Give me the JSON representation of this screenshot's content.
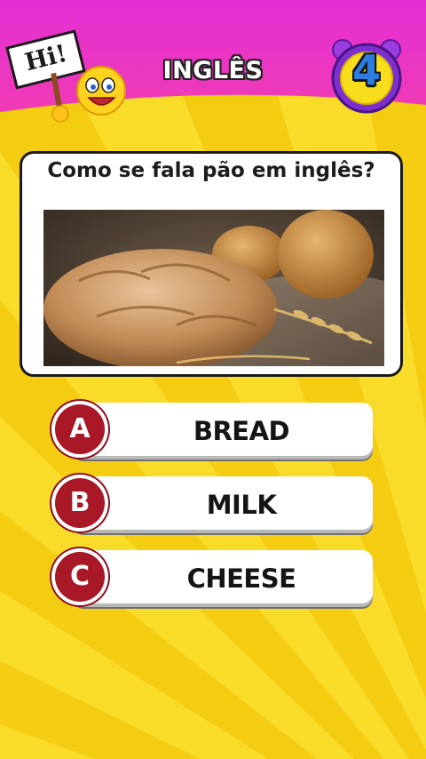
{
  "header": {
    "title": "INGLÊS",
    "sign_text": "Hi!",
    "timer_value": "4"
  },
  "question": {
    "text": "Como se fala pão em inglês?",
    "image_subject": "bread loaves with wheat stalks"
  },
  "answers": [
    {
      "letter": "A",
      "label": "BREAD"
    },
    {
      "letter": "B",
      "label": "MILK"
    },
    {
      "letter": "C",
      "label": "CHEESE"
    }
  ],
  "colors": {
    "header_magenta": "#e62fd6",
    "background_yellow": "#f7d21a",
    "answer_badge_red": "#a81826",
    "timer_purple": "#7d2fd0",
    "timer_yellow": "#f8dd1c"
  }
}
